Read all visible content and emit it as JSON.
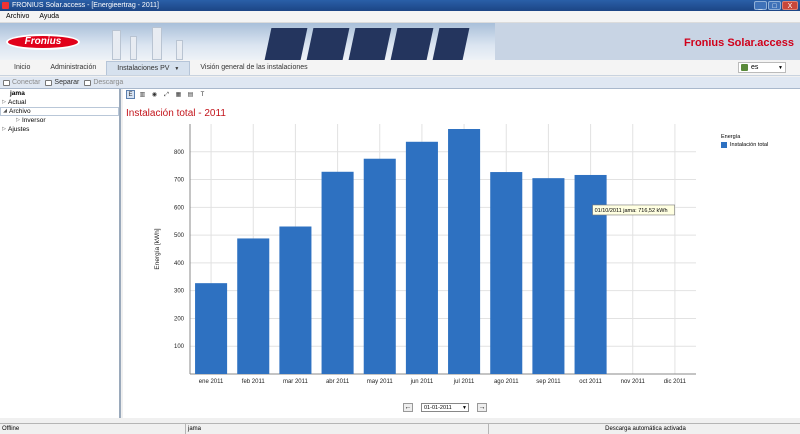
{
  "window": {
    "title": "FRONIUS Solar.access - [Energieertrag - 2011]",
    "min": "_",
    "max": "□",
    "close": "X"
  },
  "menu": {
    "file": "Archivo",
    "help": "Ayuda"
  },
  "header": {
    "logo": "Fronius",
    "brand": "Fronius Solar.access"
  },
  "nav": {
    "tabs": [
      {
        "label": "Inicio"
      },
      {
        "label": "Administración"
      },
      {
        "label": "Instalaciones PV"
      },
      {
        "label": "Visión general de las instalaciones"
      }
    ],
    "language": "es"
  },
  "toolbar": {
    "connect": "Conectar",
    "disconnect": "Separar",
    "download": "Descarga"
  },
  "tree": {
    "root": "jama",
    "items": [
      {
        "label": "Actual"
      },
      {
        "label": "Archivo"
      },
      {
        "label": "Inversor"
      },
      {
        "label": "Ajustes"
      }
    ]
  },
  "chart_tools": {
    "e": "E",
    "zoom": "⤢"
  },
  "chart_data": {
    "type": "bar",
    "title": "Instalación total - 2011",
    "ylabel": "Energía [kWh]",
    "xlabel": "",
    "categories": [
      "ene 2011",
      "feb 2011",
      "mar 2011",
      "abr 2011",
      "may 2011",
      "jun 2011",
      "jul 2011",
      "ago 2011",
      "sep 2011",
      "oct 2011",
      "nov 2011",
      "dic 2011"
    ],
    "series": [
      {
        "name": "Instalación total",
        "values": [
          327,
          488,
          531,
          728,
          775,
          836,
          882,
          727,
          705,
          716.52,
          null,
          null
        ],
        "color": "#2e71c1"
      }
    ],
    "ylim": [
      0,
      900
    ],
    "yticks": [
      100,
      200,
      300,
      400,
      500,
      600,
      700,
      800
    ],
    "grid": true,
    "legend": {
      "title": "Energía",
      "position": "top-right"
    },
    "tooltip": "01/10/2011 jama: 716,52 kWh"
  },
  "pager": {
    "date": "01-01-2011",
    "prev": "←",
    "next": "→"
  },
  "status": {
    "conn": "Offline",
    "device": "jama",
    "download": "Descarga automática activada"
  }
}
